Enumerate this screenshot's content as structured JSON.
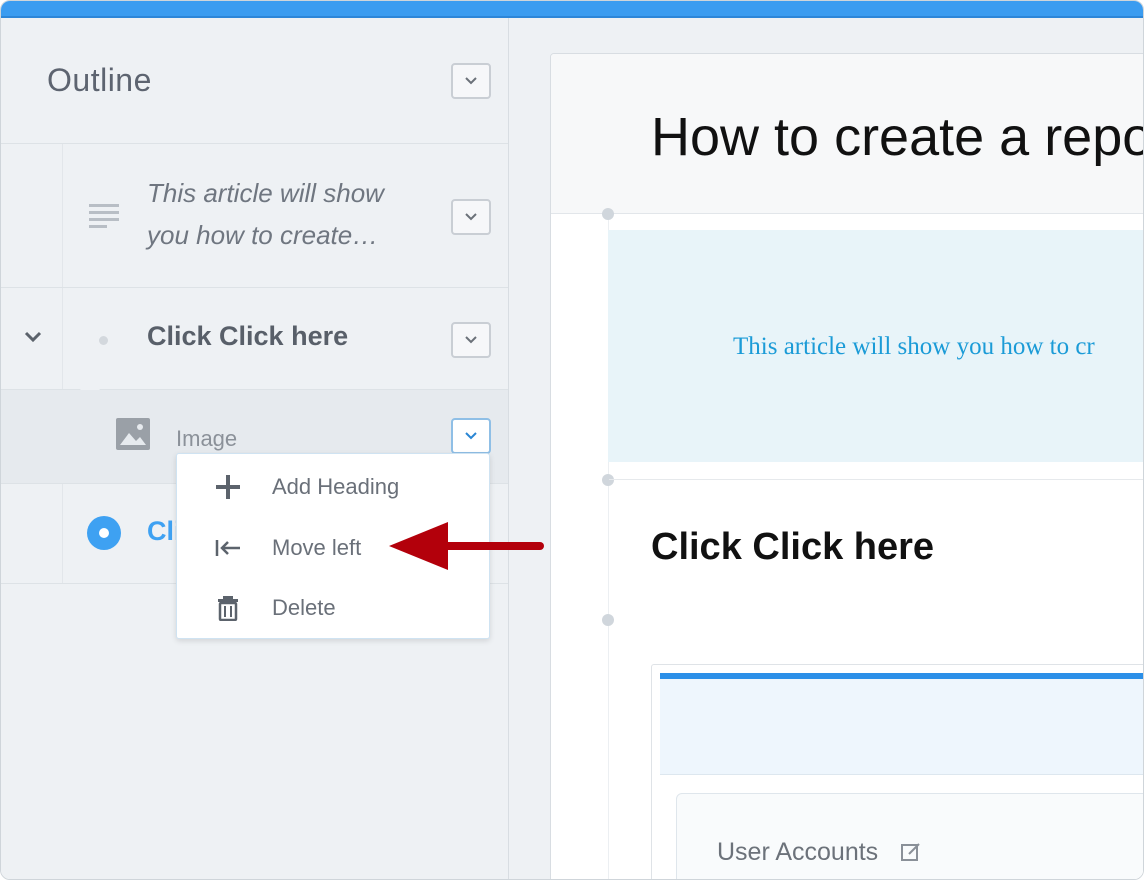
{
  "colors": {
    "accent": "#3b9cf0",
    "annotation_arrow": "#b3000b",
    "intro_text": "#1b9bd7"
  },
  "sidebar": {
    "title": "Outline",
    "items": [
      {
        "type": "paragraph",
        "text": "This article will show you how to create…",
        "icon": "lines-icon"
      },
      {
        "type": "heading",
        "text": "Click Click here",
        "icon": "dot-icon"
      },
      {
        "type": "image",
        "text": "Image",
        "icon": "image-icon"
      },
      {
        "type": "heading-current",
        "text": "Cli",
        "icon": "radio-icon"
      }
    ]
  },
  "menu": {
    "items": [
      {
        "label": "Add Heading",
        "icon": "plus-icon"
      },
      {
        "label": "Move left",
        "icon": "move-left-icon"
      },
      {
        "label": "Delete",
        "icon": "trash-icon"
      }
    ]
  },
  "editor": {
    "title": "How to create a repo",
    "intro": "This article will show you how to cr",
    "heading": "Click Click here",
    "screenshot": {
      "label": "User Accounts"
    }
  }
}
